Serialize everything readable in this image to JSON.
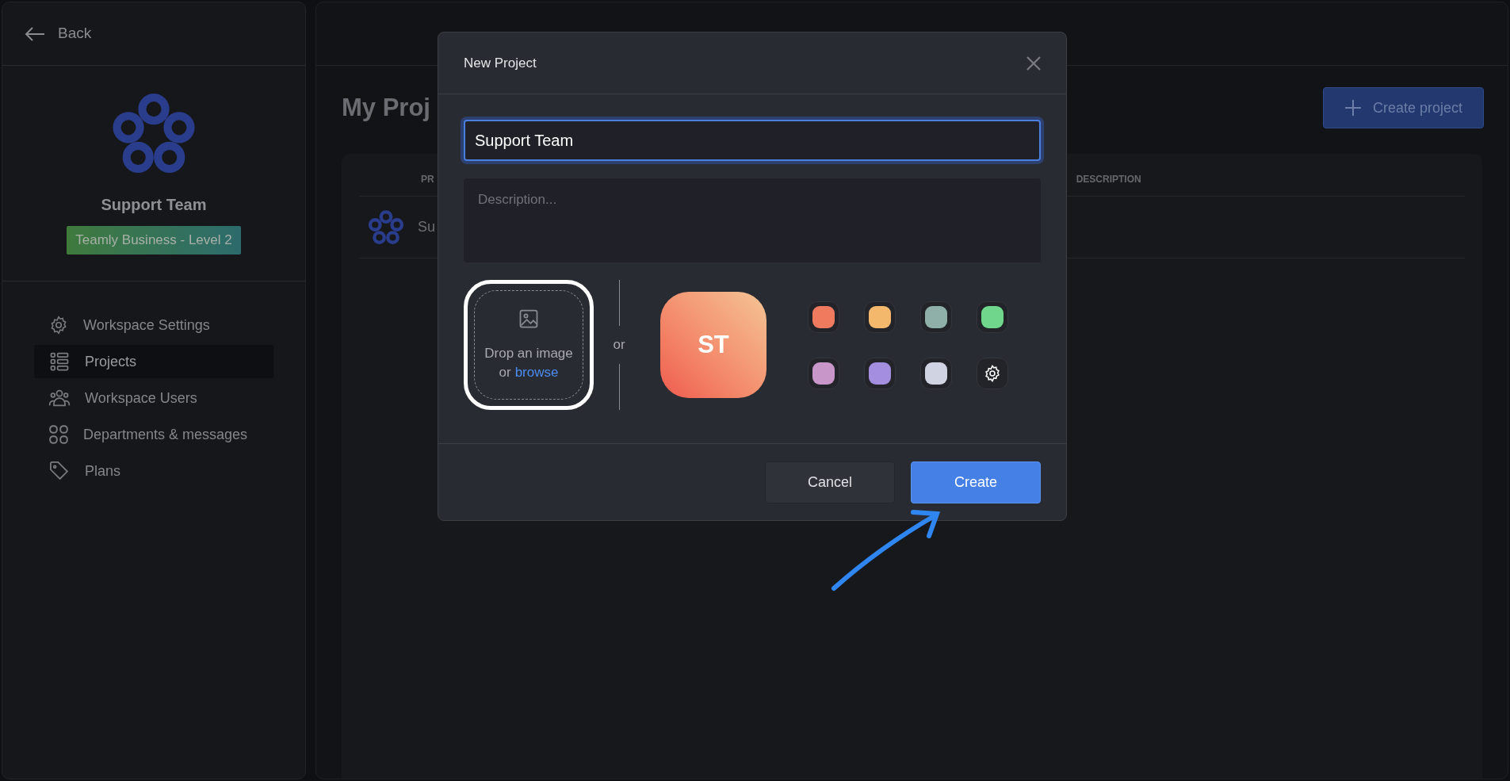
{
  "sidebar": {
    "back": "Back",
    "workspace_name": "Support Team",
    "plan_badge": "Teamly Business - Level 2",
    "items": [
      {
        "label": "Workspace Settings",
        "selected": false
      },
      {
        "label": "Projects",
        "selected": true
      },
      {
        "label": "Workspace Users",
        "selected": false
      },
      {
        "label": "Departments & messages",
        "selected": false
      },
      {
        "label": "Plans",
        "selected": false
      }
    ]
  },
  "main": {
    "title": "My Proj",
    "create_button": "Create project",
    "table": {
      "columns": [
        "PR",
        "DESCRIPTION"
      ],
      "rows": [
        {
          "name": "Su"
        }
      ]
    }
  },
  "dialog": {
    "title": "New Project",
    "name_value": "Support Team",
    "description_placeholder": "Description...",
    "drop_text": "Drop an image",
    "drop_or": "or",
    "browse_link": "browse",
    "separator": "or",
    "avatar_initials": "ST",
    "swatches": [
      {
        "color": "#f07a5e"
      },
      {
        "color": "#f3b86c"
      },
      {
        "color": "#8fb0a8"
      },
      {
        "color": "#6fd68c"
      },
      {
        "color": "#c896c8"
      },
      {
        "color": "#a48ee0"
      },
      {
        "color": "#d0d4e2"
      }
    ],
    "buttons": {
      "cancel": "Cancel",
      "create": "Create"
    }
  }
}
